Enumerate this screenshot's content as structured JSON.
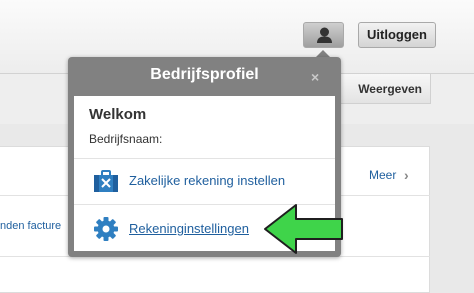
{
  "header": {
    "logout_label": "Uitloggen",
    "user_icon": "user-icon"
  },
  "subbar": {
    "view_label": "Weergeven"
  },
  "card": {
    "more_label": "Meer",
    "row_text": "nden facture"
  },
  "popover": {
    "title": "Bedrijfsprofiel",
    "close": "×",
    "welcome": "Welkom",
    "company_label": "Bedrijfsnaam:",
    "items": [
      {
        "label": "Zakelijke rekening instellen",
        "icon": "toolbox-icon"
      },
      {
        "label": "Rekeninginstellingen",
        "icon": "gear-icon"
      }
    ]
  },
  "colors": {
    "accent_link": "#1f5f9e",
    "popover_bg": "#818181",
    "arrow_green": "#3fd44a"
  }
}
